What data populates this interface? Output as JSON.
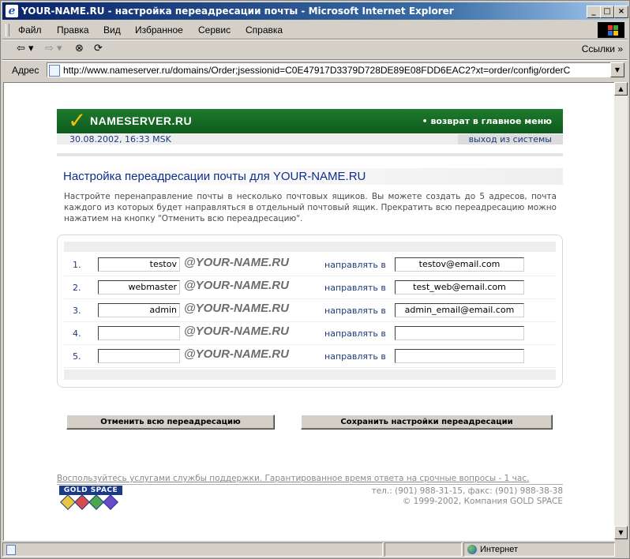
{
  "window": {
    "title": "YOUR-NAME.RU - настройка переадресации почты - Microsoft Internet Explorer",
    "min_label": "_",
    "max_label": "□",
    "close_label": "×"
  },
  "menu": {
    "items": [
      "Файл",
      "Правка",
      "Вид",
      "Избранное",
      "Сервис",
      "Справка"
    ]
  },
  "toolbar": {
    "back_glyph": "⇦ ▾",
    "forward_glyph": "⇨ ▾",
    "stop_glyph": "⊗",
    "refresh_glyph": "⟳",
    "links_label": "Ссылки »"
  },
  "address": {
    "label": "Адрес",
    "url": "http://www.nameserver.ru/domains/Order;jsessionid=C0E47917D3379D728DE89E08FDD6EAC2?xt=order/config/orderC",
    "dropdown_glyph": "▼"
  },
  "header": {
    "check": "✓",
    "logo": "NAMESERVER.RU",
    "back_link": "• возврат в главное меню",
    "datetime": "30.08.2002, 16:33 MSK",
    "logout": "выход из системы"
  },
  "page": {
    "title": "Настройка переадресации почты для YOUR-NAME.RU",
    "description": "Настройте перенаправление почты в несколько почтовых ящиков. Вы можете создать до 5 адресов, почта каждого из которых будет направляться в отдельный почтовый ящик. Прекратить всю переадресацию можно нажатием на кнопку \"Отменить всю переадресацию\"."
  },
  "forwarding": {
    "domain_suffix": "@YOUR-NAME.RU",
    "direct_label": "направлять в",
    "rows": [
      {
        "num": "1.",
        "name": "testov",
        "target": "testov@email.com"
      },
      {
        "num": "2.",
        "name": "webmaster",
        "target": "test_web@email.com"
      },
      {
        "num": "3.",
        "name": "admin",
        "target": "admin_email@email.com"
      },
      {
        "num": "4.",
        "name": "",
        "target": ""
      },
      {
        "num": "5.",
        "name": "",
        "target": ""
      }
    ]
  },
  "buttons": {
    "cancel_all": "Отменить всю переадресацию",
    "save": "Сохранить настройки переадресации"
  },
  "footer": {
    "support": "Воспользуйтесь услугами службы поддержки. Гарантированное время ответа на срочные вопросы - 1 час.",
    "phone": "тел.: (901) 988-31-15, факс: (901) 988-38-38",
    "copyright": "© 1999-2002, Компания GOLD SPACE",
    "logo_text": "GOLD SPACE"
  },
  "statusbar": {
    "zone": "Интернет"
  },
  "colors": {
    "title_bar": "#0a246a",
    "header_green": "#1f7a2e",
    "link_blue": "#1b3a7a",
    "title_blue": "#0e2e8a",
    "check_yellow": "#f2c300"
  }
}
